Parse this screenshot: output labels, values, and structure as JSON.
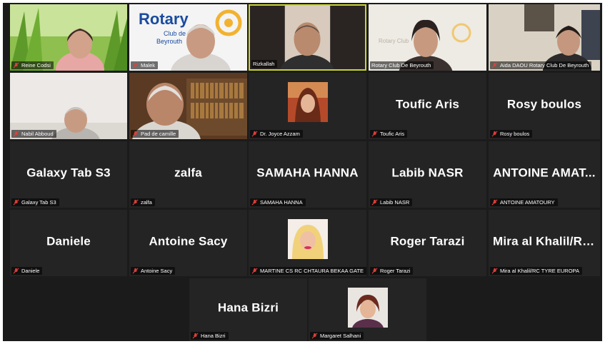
{
  "participants": [
    {
      "display": "",
      "label": "Reine Codsi",
      "kind": "video-garden"
    },
    {
      "display": "",
      "label": "Malek",
      "kind": "video-rotary"
    },
    {
      "display": "",
      "label": "Rizkallah",
      "kind": "video-dark"
    },
    {
      "display": "",
      "label": "Rotary Club De Beyrouth",
      "kind": "video-light"
    },
    {
      "display": "",
      "label": "Aida DAOU Rotary Club De Beyrouth",
      "kind": "video-room"
    },
    {
      "display": "",
      "label": "Nabil Abboud",
      "kind": "video-light2"
    },
    {
      "display": "",
      "label": "Pad de camille",
      "kind": "video-library"
    },
    {
      "display": "",
      "label": "Dr. Joyce Azzam",
      "kind": "avatar"
    },
    {
      "display": "Toufic Aris",
      "label": "Toufic Aris",
      "kind": "name"
    },
    {
      "display": "Rosy boulos",
      "label": "Rosy boulos",
      "kind": "name"
    },
    {
      "display": "Galaxy Tab S3",
      "label": "Galaxy Tab S3",
      "kind": "name"
    },
    {
      "display": "zalfa",
      "label": "zalfa",
      "kind": "name"
    },
    {
      "display": "SAMAHA HANNA",
      "label": "SAMAHA HANNA",
      "kind": "name"
    },
    {
      "display": "Labib NASR",
      "label": "Labib NASR",
      "kind": "name"
    },
    {
      "display": "ANTOINE AMAT...",
      "label": "ANTOINE AMATOURY",
      "kind": "name"
    },
    {
      "display": "Daniele",
      "label": "Daniele",
      "kind": "name"
    },
    {
      "display": "Antoine Sacy",
      "label": "Antoine Sacy",
      "kind": "name"
    },
    {
      "display": "",
      "label": "MARTINE CS RC CHTAURA BEKAA GATE",
      "kind": "avatar2"
    },
    {
      "display": "Roger Tarazi",
      "label": "Roger Tarazi",
      "kind": "name"
    },
    {
      "display": "Mira al Khalil/RC...",
      "label": "Mira al Khalil/RC TYRE EUROPA",
      "kind": "name"
    },
    {
      "display": "Hana Bizri",
      "label": "Hana Bizri",
      "kind": "name"
    },
    {
      "display": "",
      "label": "Margaret Salhani",
      "kind": "avatar3"
    }
  ],
  "rotary_logo": {
    "word": "Rotary",
    "line2": "Club de",
    "line3": "Beyrouth",
    "color": "#1a4ba0",
    "gold": "#f2b230"
  },
  "rotary_logo_small": {
    "word": "Rotary Club"
  },
  "colors": {
    "tile_bg": "#242424",
    "stage_bg": "#1b1b1b",
    "muted_mic": "#e0403a"
  },
  "icons": {
    "muted": "microphone-muted-icon"
  }
}
